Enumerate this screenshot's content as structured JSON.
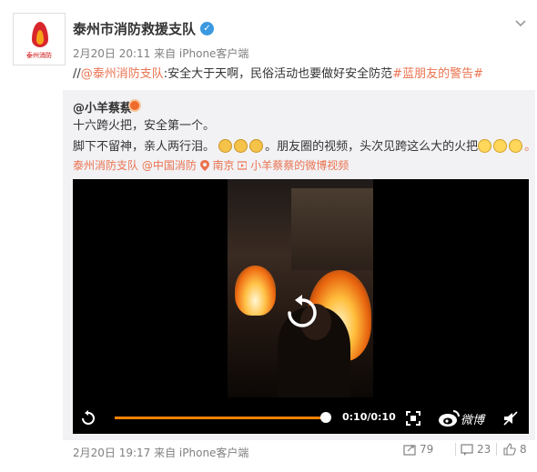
{
  "author": {
    "logo_text": "泰州消防",
    "name": "泰州市消防救援支队",
    "verified_icon": "verified-check-icon"
  },
  "post": {
    "meta": "2月20日 20:11 来自 iPhone客户端",
    "text_prefix": "//",
    "mention": "@泰州消防支队",
    "text_body": ":安全大于天啊，民俗活动也要做好安全防范",
    "hashtag": "#蓝朋友的警告#"
  },
  "repost": {
    "user": "@小羊蔡蔡",
    "line1": "十六跨火把，安全第一个。",
    "line2": "脚下不留神，亲人两行泪。",
    "line2_tail": "。朋友圈的视频，头次见跨这么大的火把",
    "line2_end": "。@",
    "links": {
      "l1": "泰州消防支队",
      "l2": "@中国消防",
      "l3": "南京",
      "l4": "小羊蔡蔡的微博视频"
    },
    "emoji_cat": "cat-face-emoji",
    "emoji_laugh": "laughing-crying-emoji"
  },
  "video": {
    "time": "0:10/0:10",
    "progress": 1.0,
    "brand": "微博"
  },
  "footer": {
    "meta": "2月20日 19:17 来自 iPhone客户端",
    "forward_count": "79",
    "comment_count": "23",
    "like_count": "8"
  },
  "colors": {
    "link": "#eb7350",
    "accent_progress": "#ff8200",
    "verified": "#3b99e0",
    "repost_bg": "#f2f2f5"
  }
}
